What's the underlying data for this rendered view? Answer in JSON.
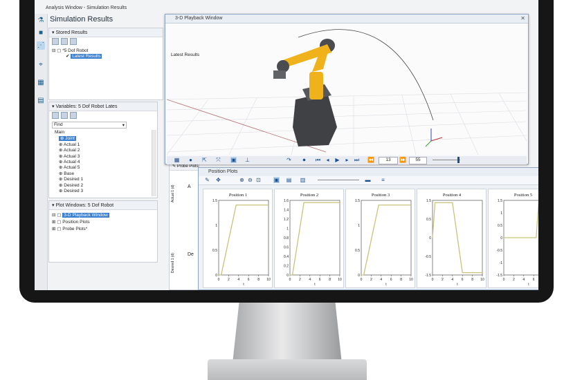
{
  "app": {
    "window_title": "Analysis Window - Simulation Results",
    "panel_heading": "Simulation Results"
  },
  "stored_results": {
    "header": "Stored Results",
    "root": "*5 Dof Robot",
    "child": "Latest Results"
  },
  "variables": {
    "header": "Variables: 5 Dof Robot Lates",
    "filter": "Find",
    "items": [
      "Main",
      "Joint",
      "Actual 1",
      "Actual 2",
      "Actual 3",
      "Actual 4",
      "Actual 5",
      "Base",
      "Desired 1",
      "Desired 2",
      "Desired 3"
    ]
  },
  "plot_windows": {
    "header": "Plot Windows: 5 Dof Robot",
    "items": [
      "3-D Playback Window",
      "Position Plots",
      "Probe Plots*"
    ]
  },
  "playback": {
    "title": "3-D Playback Window",
    "results_label": "Latest Results",
    "frame_value": "13",
    "end_value": "55"
  },
  "position_plots": {
    "title": "Position Plots",
    "probe_title": "Probe Plots"
  },
  "probe_partial": {
    "tab_1": "A",
    "tab_2": "De",
    "ylabel_1": "Actual 1 (d)",
    "ylabel_2": "Desired 1 (d)"
  },
  "chart_data": [
    {
      "type": "line",
      "title": "Position 1",
      "x": [
        0,
        0.5,
        3.5,
        10
      ],
      "y": [
        0,
        0,
        1.5,
        1.5
      ],
      "yticks": [
        "1.5",
        "1",
        "0.5",
        "0"
      ],
      "xticks": [
        "0",
        "2",
        "4",
        "6",
        "8",
        "10"
      ],
      "xlabel": "t",
      "ylim": [
        0,
        1.6
      ],
      "color": "#c8c27a"
    },
    {
      "type": "line",
      "title": "Position 2",
      "x": [
        0,
        0.5,
        2.8,
        10
      ],
      "y": [
        0,
        0,
        1.6,
        1.6
      ],
      "yticks": [
        "1.6",
        "1.4",
        "1.2",
        "1",
        "0.8",
        "0.6",
        "0.4",
        "0.2",
        "0"
      ],
      "xticks": [
        "0",
        "2",
        "4",
        "6",
        "8",
        "10"
      ],
      "xlabel": "t",
      "ylim": [
        0,
        1.65
      ],
      "color": "#c8c27a"
    },
    {
      "type": "line",
      "title": "Position 3",
      "x": [
        0,
        0.5,
        3.5,
        10
      ],
      "y": [
        0,
        0,
        1.5,
        1.5
      ],
      "yticks": [
        "1.5",
        "1",
        "0.5",
        "0"
      ],
      "xticks": [
        "0",
        "2",
        "4",
        "6",
        "8",
        "10"
      ],
      "xlabel": "t",
      "ylim": [
        0,
        1.6
      ],
      "color": "#c8c27a"
    },
    {
      "type": "line",
      "title": "Position 4",
      "x": [
        0,
        0.5,
        4,
        6,
        10
      ],
      "y": [
        0,
        1.5,
        1.5,
        -1.5,
        -1.5
      ],
      "yticks": [
        "1.5",
        "0.5",
        "0",
        "-0.5",
        "-1.5"
      ],
      "xticks": [
        "0",
        "2",
        "4",
        "6",
        "8",
        "10"
      ],
      "xlabel": "t",
      "ylim": [
        -1.6,
        1.6
      ],
      "color": "#c8c27a"
    },
    {
      "type": "line",
      "title": "Position 5",
      "x": [
        0,
        6.5,
        7,
        7.6,
        8.2,
        8.8,
        9.4,
        10
      ],
      "y": [
        0,
        0,
        1.5,
        -1.5,
        1.5,
        -1.5,
        1.5,
        -1.5
      ],
      "yticks": [
        "1.5",
        "1",
        "0.5",
        "0",
        "-0.5",
        "-1",
        "-1.5"
      ],
      "xticks": [
        "0",
        "2",
        "4",
        "6",
        "8",
        "10"
      ],
      "xlabel": "t",
      "ylim": [
        -1.6,
        1.6
      ],
      "color": "#c8c27a"
    }
  ]
}
